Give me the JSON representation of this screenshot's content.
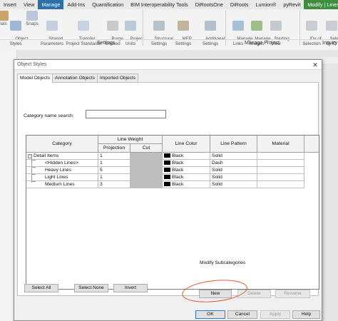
{
  "ribbon": {
    "tabs": [
      {
        "label": "Insert"
      },
      {
        "label": "View"
      },
      {
        "label": "Manage"
      },
      {
        "label": "Add-Ins"
      },
      {
        "label": "Quantification"
      },
      {
        "label": "BIM Interoperability Tools"
      },
      {
        "label": "DiRootsOne"
      },
      {
        "label": "DiRoots"
      },
      {
        "label": "Lumion®"
      },
      {
        "label": "pyRevit"
      },
      {
        "label": "Modify | Lines"
      }
    ],
    "buttons": [
      {
        "label": "rials"
      },
      {
        "label": "Object\nStyles"
      },
      {
        "label": "Snaps"
      },
      {
        "label": "Shared\nParameters"
      },
      {
        "label": "Transfer\nProject Standards"
      },
      {
        "label": "Purge\nUnused"
      },
      {
        "label": "Project\nUnits"
      },
      {
        "label": "Structural\nSettings"
      },
      {
        "label": "MEP\nSettings"
      },
      {
        "label": "Additional\nSettings"
      },
      {
        "label": "Manage\nLinks"
      },
      {
        "label": "Manage\nImages"
      },
      {
        "label": "Starting\nView"
      },
      {
        "label": "IDs of\nSelection"
      },
      {
        "label": "Select\nby ID"
      }
    ],
    "groups": [
      {
        "label": "Settings"
      },
      {
        "label": "Manage Project"
      },
      {
        "label": "Inquiry"
      }
    ]
  },
  "dialog": {
    "title": "Object Styles",
    "close_glyph": "✕",
    "tabs": [
      {
        "label": "Model Objects"
      },
      {
        "label": "Annotation Objects"
      },
      {
        "label": "Imported Objects"
      }
    ],
    "search_label": "Category name search:",
    "search_value": "",
    "table": {
      "headers": {
        "category": "Category",
        "line_weight": "Line Weight",
        "projection": "Projection",
        "cut": "Cut",
        "line_color": "Line Color",
        "line_pattern": "Line Pattern",
        "material": "Material"
      },
      "rows": [
        {
          "category": "Detail Items",
          "projection": "1",
          "cut": "",
          "color": "Black",
          "pattern": "Solid",
          "material": "",
          "expander": "−"
        },
        {
          "category": "<Hidden Lines>",
          "projection": "1",
          "cut": "",
          "color": "Black",
          "pattern": "Dash",
          "material": ""
        },
        {
          "category": "Heavy Lines",
          "projection": "5",
          "cut": "",
          "color": "Black",
          "pattern": "Solid",
          "material": ""
        },
        {
          "category": "Light Lines",
          "projection": "1",
          "cut": "",
          "color": "Black",
          "pattern": "Solid",
          "material": ""
        },
        {
          "category": "Medium Lines",
          "projection": "3",
          "cut": "",
          "color": "Black",
          "pattern": "Solid",
          "material": ""
        }
      ]
    },
    "buttons": {
      "select_all": "Select All",
      "select_none": "Select None",
      "invert": "Invert",
      "new": "New",
      "delete": "Delete",
      "rename": "Rename",
      "ok": "OK",
      "cancel": "Cancel",
      "apply": "Apply",
      "help": "Help"
    },
    "modify_subcategories_label": "Modify Subcategories"
  },
  "colors": {
    "manage_tab": "#2f6fa7",
    "modify_tab": "#3f8e3f",
    "highlight_ellipse": "#e0522a",
    "swatch": "#000000"
  }
}
